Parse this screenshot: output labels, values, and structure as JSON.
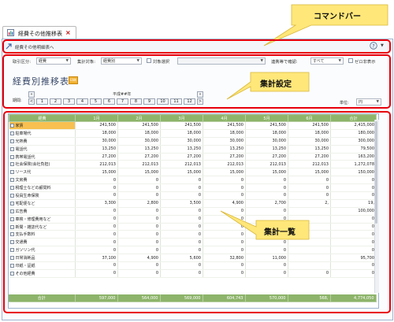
{
  "tab": {
    "label": "経費その他推移表",
    "close": "×"
  },
  "command_bar": {
    "label": "経費その他明細表へ"
  },
  "filters": {
    "category_label": "取引区分:",
    "category_value": "経費",
    "target_label": "集計対象:",
    "target_value": "経費別",
    "target_select_label": "対象選択",
    "check_label": "連携等で確認:",
    "check_value": "すべて",
    "zero_label": "ゼロ非表示"
  },
  "title": "経費別推移表",
  "badge": "印刷",
  "period": {
    "label": "期間:",
    "year": "平成##年",
    "months": [
      "1",
      "2",
      "3",
      "4",
      "5",
      "6",
      "7",
      "8",
      "9",
      "10",
      "11",
      "12"
    ],
    "nav_prev_prev": "«",
    "nav_prev": "<",
    "nav_next": ">",
    "nav_next_next": "»"
  },
  "unit": {
    "label": "単位:",
    "value": "円"
  },
  "grid": {
    "headers": [
      "経費",
      "1月",
      "2月",
      "3月",
      "4月",
      "5月",
      "6月",
      "合計"
    ],
    "rows": [
      {
        "name": "家賃",
        "v": [
          "241,500",
          "241,500",
          "241,500",
          "241,500",
          "241,500",
          "241,500",
          "2,415,000"
        ],
        "selected": true
      },
      {
        "name": "駐車場代",
        "v": [
          "18,000",
          "18,000",
          "18,000",
          "18,000",
          "18,000",
          "18,000",
          "180,000"
        ]
      },
      {
        "name": "光熱費",
        "v": [
          "30,000",
          "30,000",
          "30,000",
          "30,000",
          "30,000",
          "30,000",
          "300,000"
        ]
      },
      {
        "name": "電話代",
        "v": [
          "13,250",
          "13,250",
          "13,250",
          "13,250",
          "13,250",
          "13,250",
          "79,500"
        ]
      },
      {
        "name": "携帯電話代",
        "v": [
          "27,200",
          "27,200",
          "27,200",
          "27,200",
          "27,200",
          "27,200",
          "163,200"
        ]
      },
      {
        "name": "社会保険(会社負担)",
        "v": [
          "212,013",
          "212,013",
          "212,013",
          "212,013",
          "212,013",
          "212,013",
          "1,272,078"
        ]
      },
      {
        "name": "リース代",
        "v": [
          "15,000",
          "15,000",
          "15,000",
          "15,000",
          "15,000",
          "15,000",
          "150,000"
        ]
      },
      {
        "name": "文房費",
        "v": [
          "0",
          "0",
          "0",
          "0",
          "0",
          "0",
          "0"
        ]
      },
      {
        "name": "税理士などの顧問料",
        "v": [
          "0",
          "0",
          "0",
          "0",
          "0",
          "0",
          "0"
        ]
      },
      {
        "name": "役員生命保険",
        "v": [
          "0",
          "0",
          "0",
          "0",
          "0",
          "0",
          "0"
        ]
      },
      {
        "name": "宅配便など",
        "v": [
          "3,300",
          "2,800",
          "3,500",
          "4,900",
          "2,700",
          "2,",
          "19,"
        ]
      },
      {
        "name": "広告費",
        "v": [
          "0",
          "0",
          "0",
          "0",
          "0",
          "",
          "100,000"
        ]
      },
      {
        "name": "車検・修理費用など",
        "v": [
          "0",
          "0",
          "0",
          "0",
          "0",
          "",
          "0"
        ]
      },
      {
        "name": "新聞・雑誌代など",
        "v": [
          "0",
          "0",
          "0",
          "0",
          "0",
          "",
          "0"
        ]
      },
      {
        "name": "支払手数料",
        "v": [
          "0",
          "0",
          "0",
          "0",
          "0",
          "",
          "0"
        ]
      },
      {
        "name": "交通費",
        "v": [
          "0",
          "0",
          "0",
          "0",
          "0",
          "",
          "0"
        ]
      },
      {
        "name": "ガソリン代",
        "v": [
          "0",
          "0",
          "0",
          "0",
          "0",
          "",
          "0"
        ]
      },
      {
        "name": "日常消耗品",
        "v": [
          "37,100",
          "4,900",
          "5,600",
          "32,800",
          "11,000",
          "",
          "95,700"
        ]
      },
      {
        "name": "印紙・証紙",
        "v": [
          "0",
          "0",
          "0",
          "0",
          "0",
          "",
          "0"
        ]
      },
      {
        "name": "その他経費",
        "v": [
          "0",
          "0",
          "0",
          "0",
          "0",
          "0",
          "0"
        ]
      }
    ],
    "total": {
      "name": "合計",
      "v": [
        "597,000",
        "564,000",
        "569,000",
        "604,743",
        "570,000",
        "568,",
        "4,774,050"
      ]
    }
  },
  "callouts": {
    "command_bar": "コマンドバー",
    "settings": "集計設定",
    "list": "集計一覧"
  },
  "colors": {
    "header_green": "#8db46a",
    "highlight": "#f8c050",
    "callout": "#ffe77a",
    "frame_red": "#e8000b"
  }
}
